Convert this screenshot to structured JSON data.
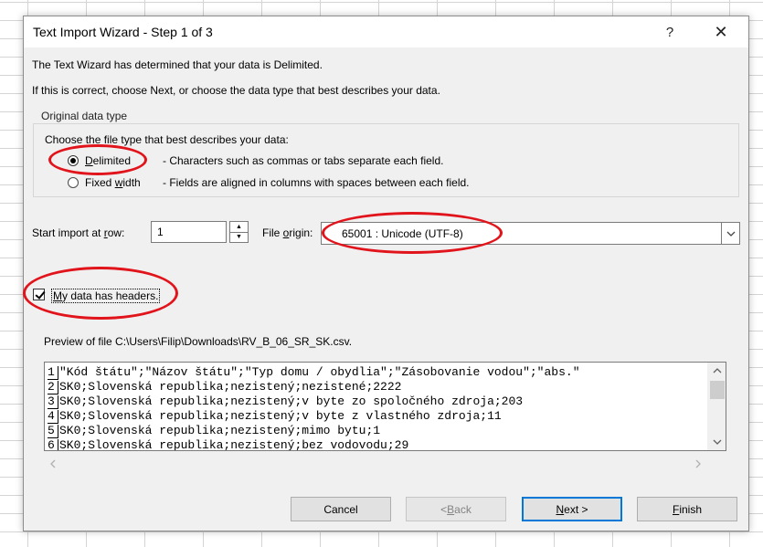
{
  "dialog": {
    "title": "Text Import Wizard - Step 1 of 3",
    "help_glyph": "?",
    "close_glyph": "✕"
  },
  "intro": {
    "line1": "The Text Wizard has determined that your data is Delimited.",
    "line2": "If this is correct, choose Next, or choose the data type that best describes your data."
  },
  "original_data_type": {
    "legend": "Original data type",
    "prompt": "Choose the file type that best describes your data:",
    "options": [
      {
        "label_pre": "",
        "label_mnemonic": "D",
        "label_post": "elimited",
        "description": "- Characters such as commas or tabs separate each field.",
        "selected": true
      },
      {
        "label_pre": "Fixed ",
        "label_mnemonic": "w",
        "label_post": "idth",
        "description": "- Fields are aligned in columns with spaces between each field.",
        "selected": false
      }
    ]
  },
  "start_row": {
    "label_pre": "Start import at ",
    "label_mnemonic": "r",
    "label_post": "ow:",
    "value": "1"
  },
  "file_origin": {
    "label_pre": "File ",
    "label_mnemonic": "o",
    "label_post": "rigin:",
    "value": "65001 : Unicode (UTF-8)"
  },
  "headers": {
    "label_pre": "",
    "label_mnemonic": "M",
    "label_post": "y data has headers.",
    "checked": true
  },
  "preview": {
    "caption": "Preview of file C:\\Users\\Filip\\Downloads\\RV_B_06_SR_SK.csv.",
    "lines": [
      {
        "num": "1",
        "text": "\"Kód štátu\";\"Názov štátu\";\"Typ domu / obydlia\";\"Zásobovanie vodou\";\"abs.\""
      },
      {
        "num": "2",
        "text": "SK0;Slovenská republika;nezistený;nezistené;2222"
      },
      {
        "num": "3",
        "text": "SK0;Slovenská republika;nezistený;v byte zo spoločného zdroja;203"
      },
      {
        "num": "4",
        "text": "SK0;Slovenská republika;nezistený;v byte z vlastného zdroja;11"
      },
      {
        "num": "5",
        "text": "SK0;Slovenská republika;nezistený;mimo bytu;1"
      },
      {
        "num": "6",
        "text": "SK0;Slovenská republika;nezistený;bez vodovodu;29"
      }
    ]
  },
  "buttons": {
    "cancel": {
      "pre": "Cancel",
      "mn": "",
      "post": ""
    },
    "back": {
      "pre": "< ",
      "mn": "B",
      "post": "ack"
    },
    "next": {
      "pre": "",
      "mn": "N",
      "post": "ext >"
    },
    "finish": {
      "pre": "",
      "mn": "F",
      "post": "inish"
    }
  },
  "icons": {
    "spin_up": "up-triangle-icon",
    "spin_down": "down-triangle-icon",
    "dropdown": "chevron-down-icon"
  },
  "colors": {
    "dialog_bg": "#f0f0f0",
    "annotation_red": "#e1131b",
    "default_button_border": "#0078d7"
  }
}
